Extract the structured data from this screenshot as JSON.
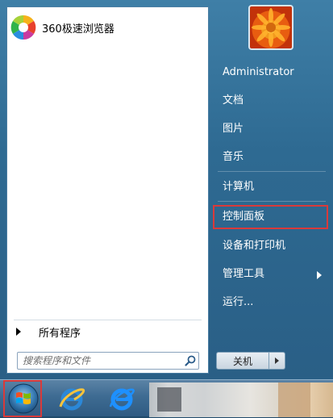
{
  "left_pane": {
    "pinned": [
      {
        "label": "360极速浏览器",
        "icon": "browser-360-icon"
      }
    ],
    "all_programs_label": "所有程序",
    "search": {
      "placeholder": "搜索程序和文件"
    }
  },
  "right_pane": {
    "user_picture": "user-avatar-flower",
    "items": [
      {
        "label": "Administrator"
      },
      {
        "label": "文档"
      },
      {
        "label": "图片"
      },
      {
        "label": "音乐"
      },
      {
        "label": "计算机"
      },
      {
        "label": "控制面板"
      },
      {
        "label": "设备和打印机"
      },
      {
        "label": "管理工具"
      },
      {
        "label": "运行..."
      }
    ],
    "shutdown_label": "关机"
  },
  "taskbar": {
    "start_button": "windows-start-icon",
    "pinned_icons": [
      "ie-icon",
      "ie-icon"
    ]
  },
  "colors": {
    "highlight": "#d93a3a",
    "menu_blue": "#2e6a92",
    "taskbar_blue": "#3e6b92"
  }
}
